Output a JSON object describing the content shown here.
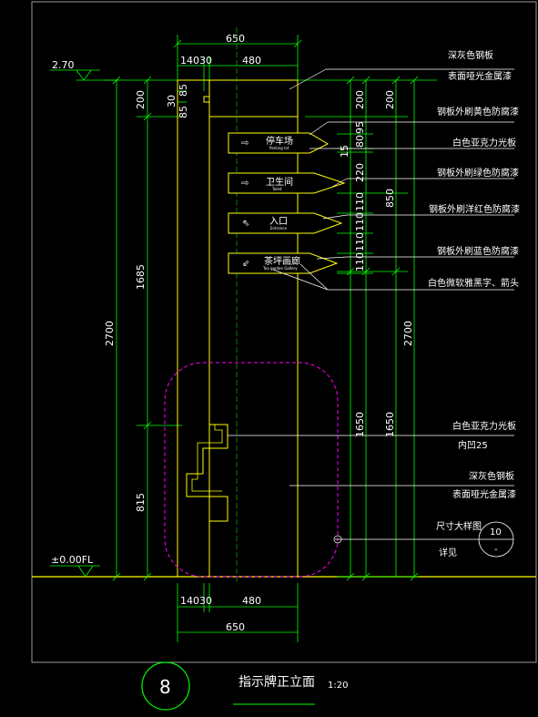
{
  "drawing": {
    "number": "8",
    "title": "指示牌正立面",
    "scale": "1:20"
  },
  "levels": {
    "top": "2.70",
    "floor": "±0.00FL"
  },
  "dims_top": {
    "total": "650",
    "left": "140",
    "gap": "30",
    "right": "480"
  },
  "dims_bottom": {
    "total": "650",
    "left": "140",
    "gap": "30",
    "right": "480"
  },
  "dims_left": {
    "d200": "200",
    "d30": "30",
    "d85": "85",
    "d85b": "85",
    "d1685": "1685",
    "d815": "815",
    "d2700": "2700"
  },
  "dims_right": {
    "c200": "200",
    "c95": "95",
    "c80": "80",
    "c15": "15",
    "c220": "220",
    "c110a": "110",
    "c110b": "110",
    "c110c": "110",
    "c110d": "110",
    "c1650": "1650",
    "r200": "200",
    "r850": "850",
    "r1650": "1650",
    "r2700": "2700"
  },
  "signs": [
    {
      "cn": "停车场",
      "en": "Parking lot",
      "icon": "arrow-right-icon"
    },
    {
      "cn": "卫生间",
      "en": "Toilet",
      "icon": "arrow-right-icon"
    },
    {
      "cn": "入口",
      "en": "Entrance",
      "icon": "arrow-up-left-icon"
    },
    {
      "cn": "茶坪画廊",
      "en": "Tea garden Gallery",
      "icon": "arrow-down-left-icon"
    }
  ],
  "notes": [
    "深灰色钢板",
    "表面哑光金属漆",
    "钢板外刷黄色防腐漆",
    "白色亚克力光板",
    "钢板外刷绿色防腐漆",
    "钢板外刷洋红色防腐漆",
    "钢板外刷蓝色防腐漆",
    "白色微软雅黑字、箭头",
    "白色亚克力光板",
    "内凹25",
    "深灰色钢板",
    "表面哑光金属漆",
    "尺寸大样图",
    "详见"
  ],
  "detail_callout": {
    "sheet": "10",
    "dash": "-"
  }
}
